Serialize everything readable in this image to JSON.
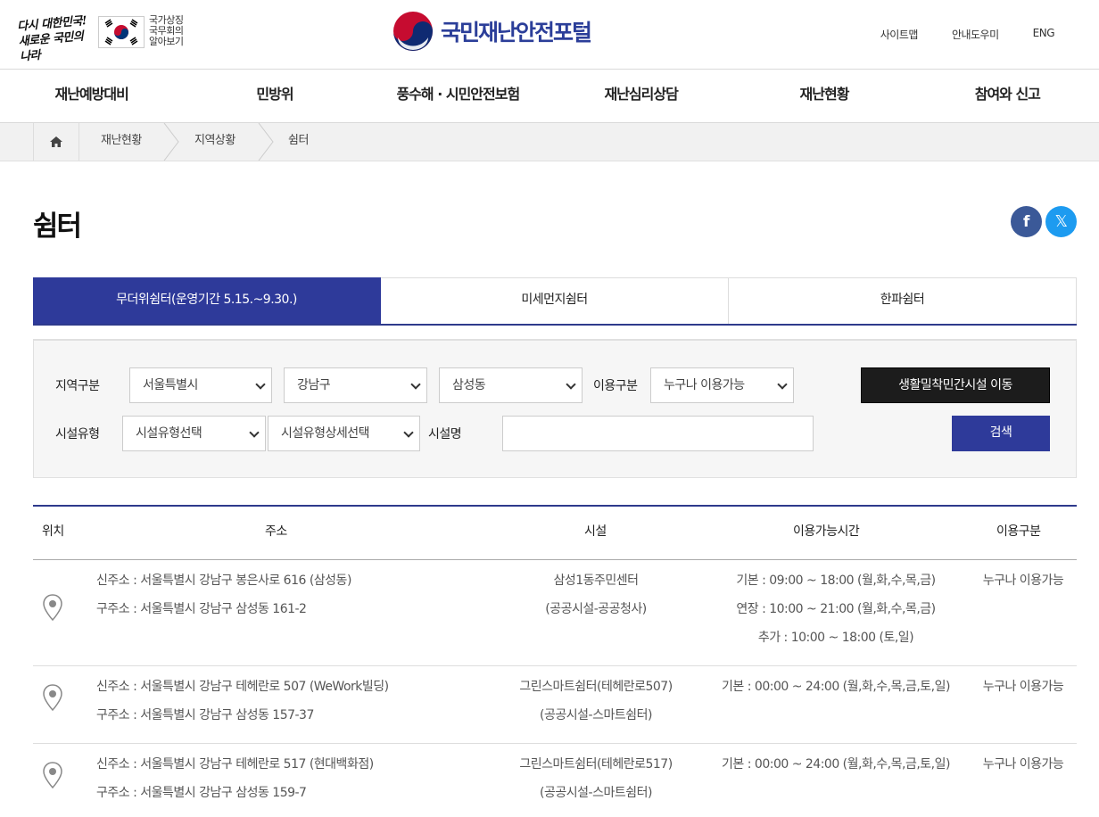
{
  "header": {
    "slogan_line1": "다시 대한민국!",
    "slogan_line2": "새로운 국민의 나라",
    "national_symbols": [
      "국가상징",
      "국무회의",
      "알아보기"
    ],
    "site_title": "국민재난안전포털",
    "utils": [
      "사이트맵",
      "안내도우미",
      "ENG"
    ]
  },
  "nav": [
    "재난예방대비",
    "민방위",
    "풍수해 · 시민안전보험",
    "재난심리상담",
    "재난현황",
    "참여와 신고"
  ],
  "breadcrumb": [
    "재난현황",
    "지역상황",
    "쉼터"
  ],
  "page": {
    "title": "쉼터"
  },
  "tabs": [
    "무더위쉼터(운영기간 5.15.~9.30.)",
    "미세먼지쉼터",
    "한파쉼터"
  ],
  "search": {
    "region_label": "지역구분",
    "sido": "서울특별시",
    "sigungu": "강남구",
    "dong": "삼성동",
    "usage_label": "이용구분",
    "usage": "누구나 이용가능",
    "move_button": "생활밀착민간시설 이동",
    "type_label": "시설유형",
    "type": "시설유형선택",
    "type_detail": "시설유형상세선택",
    "name_label": "시설명",
    "name_value": "",
    "search_button": "검색"
  },
  "table": {
    "headers": [
      "위치",
      "주소",
      "시설",
      "이용가능시간",
      "이용구분"
    ],
    "rows": [
      {
        "new_addr": "신주소 : 서울특별시 강남구 봉은사로 616 (삼성동)",
        "old_addr": "구주소 : 서울특별시 강남구 삼성동 161-2",
        "facility": "삼성1동주민센터",
        "facility_type": "(공공시설-공공청사)",
        "hours": [
          "기본 : 09:00 ~ 18:00 (월,화,수,목,금)",
          "연장 : 10:00 ~ 21:00 (월,화,수,목,금)",
          "추가 : 10:00 ~ 18:00 (토,일)"
        ],
        "usage": "누구나 이용가능"
      },
      {
        "new_addr": "신주소 : 서울특별시 강남구 테헤란로 507 (WeWork빌딩)",
        "old_addr": "구주소 : 서울특별시 강남구 삼성동 157-37",
        "facility": "그린스마트쉼터(테헤란로507)",
        "facility_type": "(공공시설-스마트쉼터)",
        "hours": [
          "기본 : 00:00 ~ 24:00 (월,화,수,목,금,토,일)"
        ],
        "usage": "누구나 이용가능"
      },
      {
        "new_addr": "신주소 : 서울특별시 강남구 테헤란로 517 (현대백화점)",
        "old_addr": "구주소 : 서울특별시 강남구 삼성동 159-7",
        "facility": "그린스마트쉼터(테헤란로517)",
        "facility_type": "(공공시설-스마트쉼터)",
        "hours": [
          "기본 : 00:00 ~ 24:00 (월,화,수,목,금,토,일)"
        ],
        "usage": "누구나 이용가능"
      }
    ]
  },
  "colors": {
    "primary": "#2e3a9a",
    "facebook": "#3b5998",
    "twitter": "#1d9bf0",
    "dark": "#1c1c1c"
  },
  "icons": [
    "korea-flag-icon",
    "home-icon",
    "facebook-icon",
    "x-icon",
    "location-pin-icon",
    "chevron-down-icon"
  ]
}
